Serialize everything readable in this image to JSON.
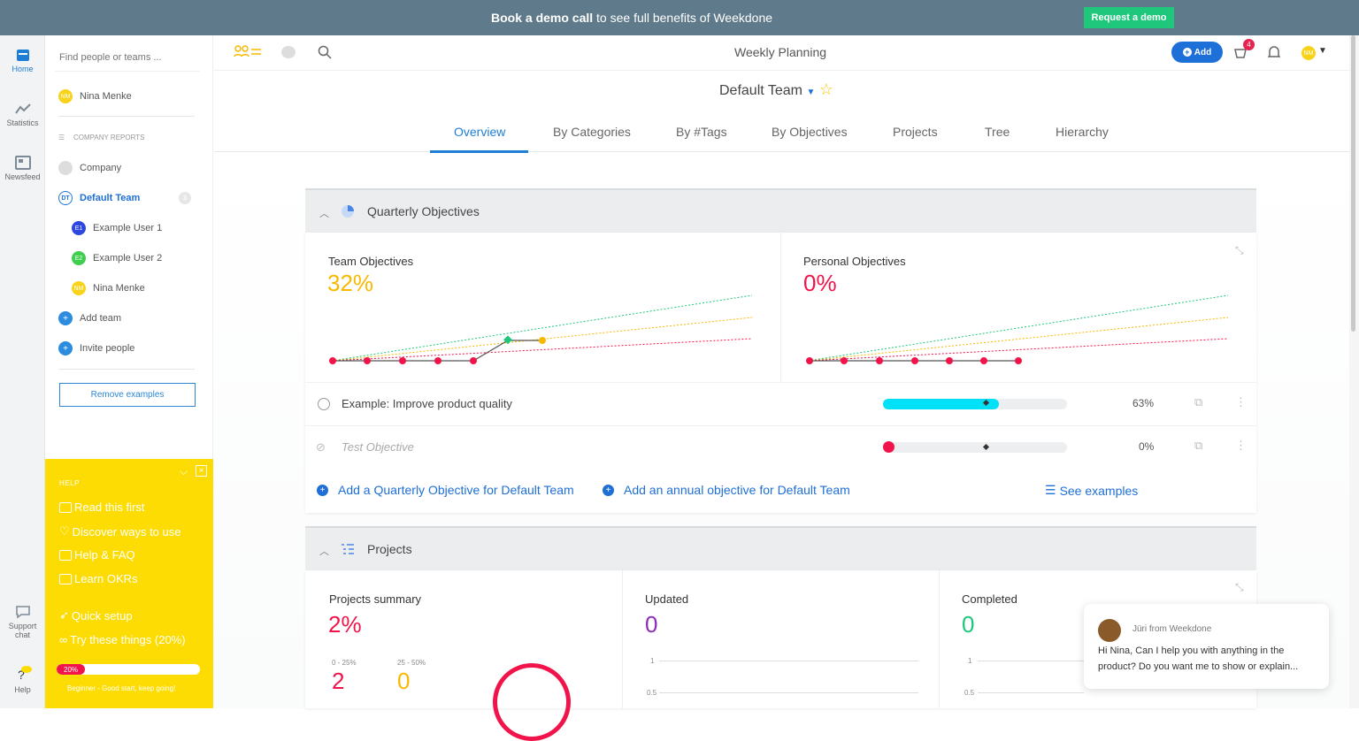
{
  "banner": {
    "bold": "Book a demo call",
    "rest": " to see full benefits of Weekdone",
    "button": "Request a demo"
  },
  "rail": {
    "home": "Home",
    "statistics": "Statistics",
    "newsfeed": "Newsfeed",
    "support": "Support chat",
    "help": "Help"
  },
  "sidebar": {
    "search_placeholder": "Find people or teams ...",
    "user": {
      "initials": "NM",
      "name": "Nina Menke"
    },
    "section": "COMPANY REPORTS",
    "company": "Company",
    "team": {
      "initials": "DT",
      "name": "Default Team",
      "count": "3"
    },
    "members": [
      {
        "initials": "E1",
        "name": "Example User 1"
      },
      {
        "initials": "E2",
        "name": "Example User 2"
      },
      {
        "initials": "NM",
        "name": "Nina Menke"
      }
    ],
    "add_team": "Add team",
    "invite": "Invite people",
    "remove": "Remove examples"
  },
  "help": {
    "head": "HELP",
    "items": [
      "Read this first",
      "Discover ways to use",
      "Help & FAQ",
      "Learn OKRs",
      "Quick setup",
      "Try these things (20%)"
    ],
    "progress": 20,
    "progress_label": "20%",
    "foot": "Beginner - Good start, keep going!"
  },
  "topbar": {
    "title": "Weekly Planning",
    "add": "Add",
    "cart_badge": "4",
    "avatar": "NM"
  },
  "team_title": "Default Team",
  "tabs": [
    "Overview",
    "By Categories",
    "By #Tags",
    "By Objectives",
    "Projects",
    "Tree",
    "Hierarchy"
  ],
  "quarterly": {
    "title": "Quarterly Objectives",
    "team_label": "Team Objectives",
    "team_pct": "32%",
    "personal_label": "Personal Objectives",
    "personal_pct": "0%",
    "objectives": [
      {
        "name": "Example: Improve product quality",
        "progress": 63,
        "pct": "63%"
      },
      {
        "name": "Test Objective",
        "progress": 0,
        "pct": "0%"
      }
    ],
    "add_quarterly": "Add a Quarterly Objective for Default Team",
    "add_annual": "Add an annual objective for Default Team",
    "examples": "See examples"
  },
  "projects": {
    "title": "Projects",
    "summary_label": "Projects summary",
    "summary_pct": "2%",
    "r1_label": "0 - 25%",
    "r1_val": "2",
    "r2_label": "25 - 50%",
    "r2_val": "0",
    "updated_label": "Updated",
    "updated_val": "0",
    "completed_label": "Completed",
    "completed_val": "0",
    "tick1": "1",
    "tick05": "0.5"
  },
  "chat": {
    "from": "Jüri from Weekdone",
    "msg": "Hi Nina, Can I help you with anything in the product? Do you want me to show or explain..."
  },
  "colors": {
    "accent": "#1e7ed6",
    "yellow": "#fddc04",
    "red": "#f0144b",
    "orange": "#f9b800",
    "green": "#1ec77b",
    "purple": "#8e2bbf"
  }
}
